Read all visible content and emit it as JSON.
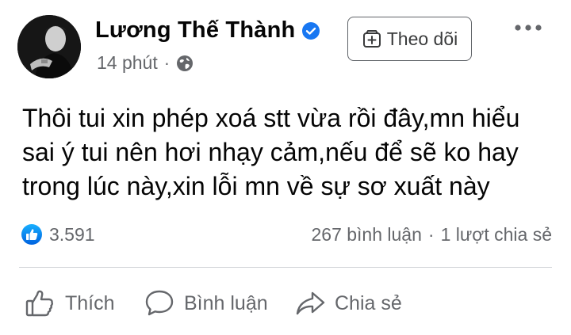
{
  "author": {
    "name": "Lương Thế Thành",
    "verified_icon": "verified-badge-icon",
    "avatar_icon": "avatar"
  },
  "meta": {
    "time": "14 phút",
    "separator": "·",
    "audience_icon": "globe-icon"
  },
  "follow": {
    "label": "Theo dõi",
    "icon": "follow-page-icon"
  },
  "more_icon": "more-horizontal-icon",
  "post": {
    "lines": [
      "Thôi tui xin phép xoá stt vừa rồi đây,mn hiểu",
      "sai ý tui nên hơi nhạy cảm,nếu để sẽ ko hay",
      "trong lúc này,xin lỗi mn về sự sơ xuất này"
    ]
  },
  "stats": {
    "reactions_count": "3.591",
    "comments": "267 bình luận",
    "separator": "·",
    "shares": "1 lượt chia sẻ"
  },
  "actions": {
    "like": "Thích",
    "comment": "Bình luận",
    "share": "Chia sẻ"
  },
  "colors": {
    "brand_blue": "#1877f2",
    "secondary_text": "#65676b",
    "primary_text": "#050505",
    "divider": "#ced0d4"
  }
}
